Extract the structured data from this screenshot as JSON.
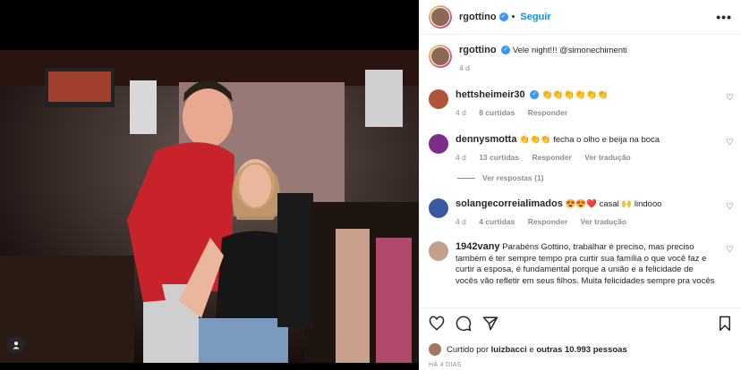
{
  "post": {
    "username": "rgottino",
    "follow_label": "Seguir",
    "more_label": "•••",
    "caption_user": "rgottino",
    "caption_text": "Vele night!!! @simonechimenti",
    "caption_time": "4 d"
  },
  "comments": [
    {
      "user": "hettsheimeir30",
      "text": "👏👏👏👏👏👏",
      "time": "4 d",
      "likes": "8 curtidas",
      "reply": "Responder",
      "translate": ""
    },
    {
      "user": "dennysmotta",
      "text": "👏👏👏 fecha o olho e beija na boca",
      "time": "4 d",
      "likes": "13 curtidas",
      "reply": "Responder",
      "translate": "Ver tradução"
    },
    {
      "user": "solangecorreialimados",
      "text": "😍😍❤️ casal 🙌 lindooo",
      "time": "4 d",
      "likes": "4 curtidas",
      "reply": "Responder",
      "translate": "Ver tradução"
    },
    {
      "user": "1942vany",
      "text": "Parabéns Gottino, trabalhar é preciso, mas preciso também é ter sempre tempo pra curtir sua família o que você faz e curtir a esposa, é fundamental porque a união e a felicidade de vocês vão refletir em seus filhos. Muita felicidades sempre pra vocês",
      "time": "",
      "likes": "",
      "reply": "",
      "translate": ""
    }
  ],
  "view_replies": "Ver respostas (1)",
  "likes_line": {
    "prefix": "Curtido por",
    "user": "luizbacci",
    "suffix": "e",
    "others": "outras 10.993 pessoas"
  },
  "date_label": "HÁ 4 DIAS",
  "colors": {
    "accent": "#0095f6",
    "verified": "#3897f0",
    "text": "#262626",
    "muted": "#8e8e8e",
    "heart": "#e02020"
  },
  "icons": [
    "heart-icon",
    "comment-icon",
    "share-icon",
    "bookmark-icon",
    "more-icon",
    "verified-icon",
    "user-tag-icon"
  ]
}
